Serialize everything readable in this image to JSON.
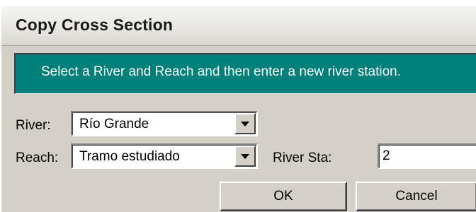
{
  "dialog": {
    "title": "Copy Cross Section",
    "instruction": "Select a River and Reach and then enter a new river station."
  },
  "form": {
    "river_label": "River:",
    "river_value": "Río Grande",
    "reach_label": "Reach:",
    "reach_value": "Tramo estudiado",
    "river_sta_label": "River Sta:",
    "river_sta_value": "2"
  },
  "buttons": {
    "ok_label": "OK",
    "cancel_label": "Cancel"
  },
  "colors": {
    "banner": "#00807a",
    "dialog_face": "#d4d0c8"
  }
}
